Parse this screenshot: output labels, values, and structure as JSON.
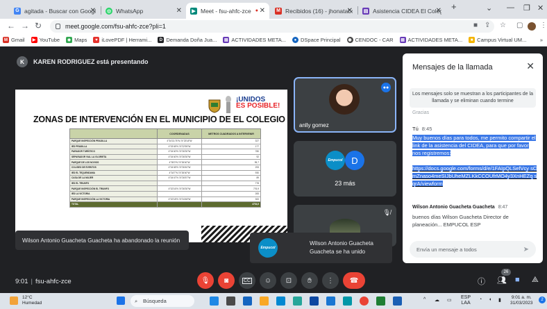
{
  "browser": {
    "tabs": [
      {
        "title": "agitada - Buscar con Google",
        "icon": "google-icon",
        "color": "#4285f4",
        "glyph": "G"
      },
      {
        "title": "WhatsApp",
        "icon": "whatsapp-icon",
        "color": "#25d366",
        "glyph": "◎"
      },
      {
        "title": "Meet - fsu-ahfc-zce",
        "icon": "meet-icon",
        "color": "#00897b",
        "glyph": "▶"
      },
      {
        "title": "Recibidos (16) - jhonatabo",
        "icon": "gmail-icon",
        "color": "#d93025",
        "glyph": "M"
      },
      {
        "title": "Asistencia CIDEA El Colegio",
        "icon": "forms-icon",
        "color": "#673ab7",
        "glyph": "▤"
      }
    ],
    "url": "meet.google.com/fsu-ahfc-zce?pli=1",
    "bookmarks": [
      {
        "label": "Gmail",
        "color": "#d93025",
        "glyph": "M"
      },
      {
        "label": "YouTube",
        "color": "#ff0000",
        "glyph": "▶"
      },
      {
        "label": "Maps",
        "color": "#34a853",
        "glyph": "◆"
      },
      {
        "label": "iLovePDF | Herrami...",
        "color": "#e5322d",
        "glyph": "♥"
      },
      {
        "label": "Demanda Doña Jua...",
        "color": "#202124",
        "glyph": "D"
      },
      {
        "label": "ACTIVIDADES META...",
        "color": "#673ab7",
        "glyph": "▤"
      },
      {
        "label": "DSpace Principal",
        "color": "#1565c0",
        "glyph": "●"
      },
      {
        "label": "CENDOC - CAR",
        "color": "#444444",
        "glyph": "◉"
      },
      {
        "label": "ACTIVIDADES META...",
        "color": "#673ab7",
        "glyph": "▤"
      },
      {
        "label": "Campus Virtual UM...",
        "color": "#f4b400",
        "glyph": "■"
      }
    ],
    "more_bookmarks": "»"
  },
  "meet": {
    "presenter_initial": "K",
    "presenting_text": "KAREN RODRIGUEZ está presentando",
    "slide": {
      "title": "ZONAS DE INTERVENCIÓN EN EL MUNICIPIO DE EL COLEGIO",
      "logo_text_1": "¡UNIDOS",
      "logo_text_2": "ES POSIBLE!",
      "columns": [
        "",
        "COORDENADAS",
        "METROS CUADRADOS A INTERVENIR"
      ],
      "rows": [
        [
          "PARQUE INSPECCIÓN PRADILLA",
          "4°34'13.76\"N 74°23'18\"W",
          "327"
        ],
        [
          "IED PRADILLA",
          "4°33'45\"N 74°22'59\"W",
          "177"
        ],
        [
          "PARADOR TURÍSTICO",
          "4°34'40\"N 74°26'30\"W",
          "780"
        ],
        [
          "SEPARADOR VIAL LA GLORIETA",
          "4°34'40\"N 74°26'30\"W",
          "92"
        ],
        [
          "PARQUE DE LOS NOVIOS",
          "4°35'0\"N 74°26'40\"W",
          "95,7"
        ],
        [
          "COLISEO DE EVENTOS",
          "4°34'45\"N 74°26'40\"W",
          "293"
        ],
        [
          "IED EL TEQUENDAMA",
          "4°34'7\"N 74°26'40\"W",
          "930"
        ],
        [
          "CASA DE LA MUJER",
          "4°34'47\"N 74°26'57\"W",
          "89"
        ],
        [
          "IED EL TRIUNFO",
          "",
          "778"
        ],
        [
          "PARQUE INSPECCIÓN EL TRIUNFO",
          "4°32'16\"N 74°26'30\"W",
          "776,9"
        ],
        [
          "IED LA VICTORIA",
          "",
          "283"
        ],
        [
          "PARQUE INSPECCIÓN LA VICTORIA",
          "4°32'18\"N 74°24'48\"W",
          "300"
        ]
      ],
      "total_label": "TOTAL",
      "total_value": "4754,9"
    },
    "tiles": {
      "gomez_name": "anlly gomez",
      "more_label": "23 más",
      "more_initial": "D",
      "empucol": "Empucol"
    },
    "notifications": {
      "left": "Wilson Antonio Guacheta Guacheta ha abandonado la reunión",
      "right": "Wilson Antonio Guacheta Guacheta se ha unido"
    },
    "chat": {
      "title": "Mensajes de la llamada",
      "info": "Los mensajes solo se muestran a los participantes de la llamada y se eliminan cuando termine",
      "prev_fragment": "Gracias",
      "msg1_sender": "Tú",
      "msg1_time": "8:45",
      "msg1_text": "Muy buenos días para todos, me permito compartir el link de la asistencia del CIDEA, para que por favor nos registremos:",
      "msg1_link": "https://docs.google.com/forms/d/e/1FAIpQLSefVcy sCmZnaso4meSIJbUheMZLKkCCOUfrMO4y3XnHEZq sqrA/viewform",
      "msg2_sender": "Wilson Antonio Guacheta Guacheta",
      "msg2_time": "8:47",
      "msg2_text": "buenos días Wilson Guacheta Director de planeación... EMPUCOL ESP",
      "input_placeholder": "Envía un mensaje a todos"
    },
    "meeting_time": "9:01",
    "meeting_code": "fsu-ahfc-zce",
    "participants_count": "26"
  },
  "taskbar": {
    "temperature": "12°C",
    "weather_desc": "Humedad",
    "search_label": "Búsqueda",
    "lang": "ESP",
    "lang2": "LAA",
    "time": "9:01 a. m.",
    "date": "31/03/2023",
    "notif_count": "2"
  }
}
